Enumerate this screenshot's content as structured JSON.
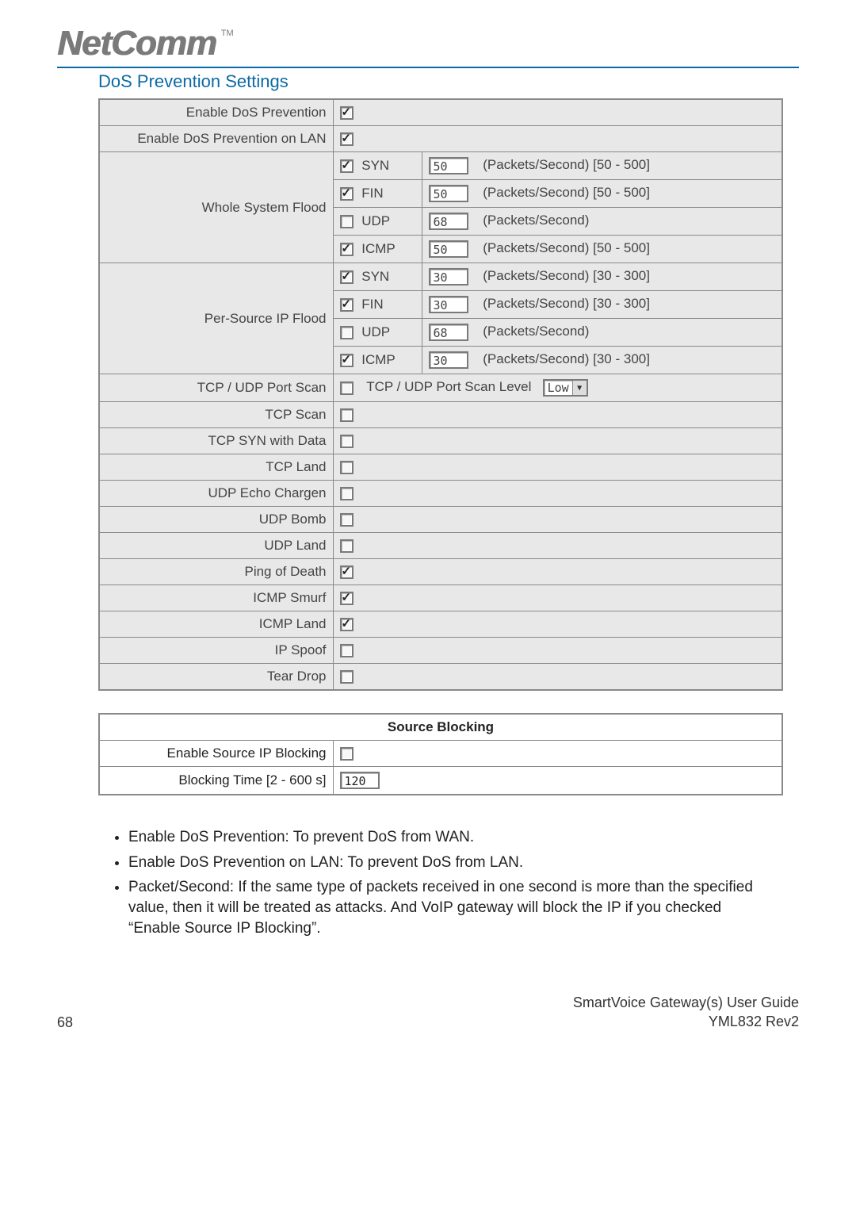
{
  "brand": {
    "name": "NetComm",
    "tm": "TM"
  },
  "section_title": "DoS Prevention Settings",
  "table": {
    "enable_dos": {
      "label": "Enable DoS Prevention",
      "checked": true
    },
    "enable_dos_lan": {
      "label": "Enable DoS Prevention on LAN",
      "checked": true
    },
    "whole_system_flood": {
      "label": "Whole System Flood",
      "rows": [
        {
          "name": "SYN",
          "checked": true,
          "value": "50",
          "suffix": "(Packets/Second) [50 - 500]"
        },
        {
          "name": "FIN",
          "checked": true,
          "value": "50",
          "suffix": "(Packets/Second) [50 - 500]"
        },
        {
          "name": "UDP",
          "checked": false,
          "value": "68",
          "suffix": "(Packets/Second)"
        },
        {
          "name": "ICMP",
          "checked": true,
          "value": "50",
          "suffix": "(Packets/Second) [50 - 500]"
        }
      ]
    },
    "per_source_flood": {
      "label": "Per-Source IP Flood",
      "rows": [
        {
          "name": "SYN",
          "checked": true,
          "value": "30",
          "suffix": "(Packets/Second) [30 - 300]"
        },
        {
          "name": "FIN",
          "checked": true,
          "value": "30",
          "suffix": "(Packets/Second) [30 - 300]"
        },
        {
          "name": "UDP",
          "checked": false,
          "value": "68",
          "suffix": "(Packets/Second)"
        },
        {
          "name": "ICMP",
          "checked": true,
          "value": "30",
          "suffix": "(Packets/Second) [30 - 300]"
        }
      ]
    },
    "port_scan": {
      "label": "TCP / UDP Port Scan",
      "checked": false,
      "level_label": "TCP / UDP Port Scan Level",
      "level_value": "Low"
    },
    "simple": [
      {
        "label": "TCP Scan",
        "checked": false
      },
      {
        "label": "TCP SYN with Data",
        "checked": false
      },
      {
        "label": "TCP Land",
        "checked": false
      },
      {
        "label": "UDP Echo Chargen",
        "checked": false
      },
      {
        "label": "UDP Bomb",
        "checked": false
      },
      {
        "label": "UDP Land",
        "checked": false
      },
      {
        "label": "Ping of Death",
        "checked": true
      },
      {
        "label": "ICMP Smurf",
        "checked": true
      },
      {
        "label": "ICMP Land",
        "checked": true
      },
      {
        "label": "IP Spoof",
        "checked": false
      },
      {
        "label": "Tear Drop",
        "checked": false
      }
    ]
  },
  "source_blocking": {
    "title": "Source Blocking",
    "enable": {
      "label": "Enable Source IP Blocking",
      "checked": false
    },
    "time": {
      "label": "Blocking Time [2 - 600 s]",
      "value": "120"
    }
  },
  "notes": [
    "Enable DoS Prevention: To prevent DoS from WAN.",
    "Enable DoS Prevention on LAN: To prevent DoS from LAN.",
    "Packet/Second: If the same type of packets received in one second is more than the specified value, then it will be treated as attacks. And VoIP gateway will block the IP if you checked “Enable Source IP Blocking”."
  ],
  "footer": {
    "page": "68",
    "guide": "SmartVoice Gateway(s) User Guide",
    "rev": "YML832 Rev2"
  }
}
